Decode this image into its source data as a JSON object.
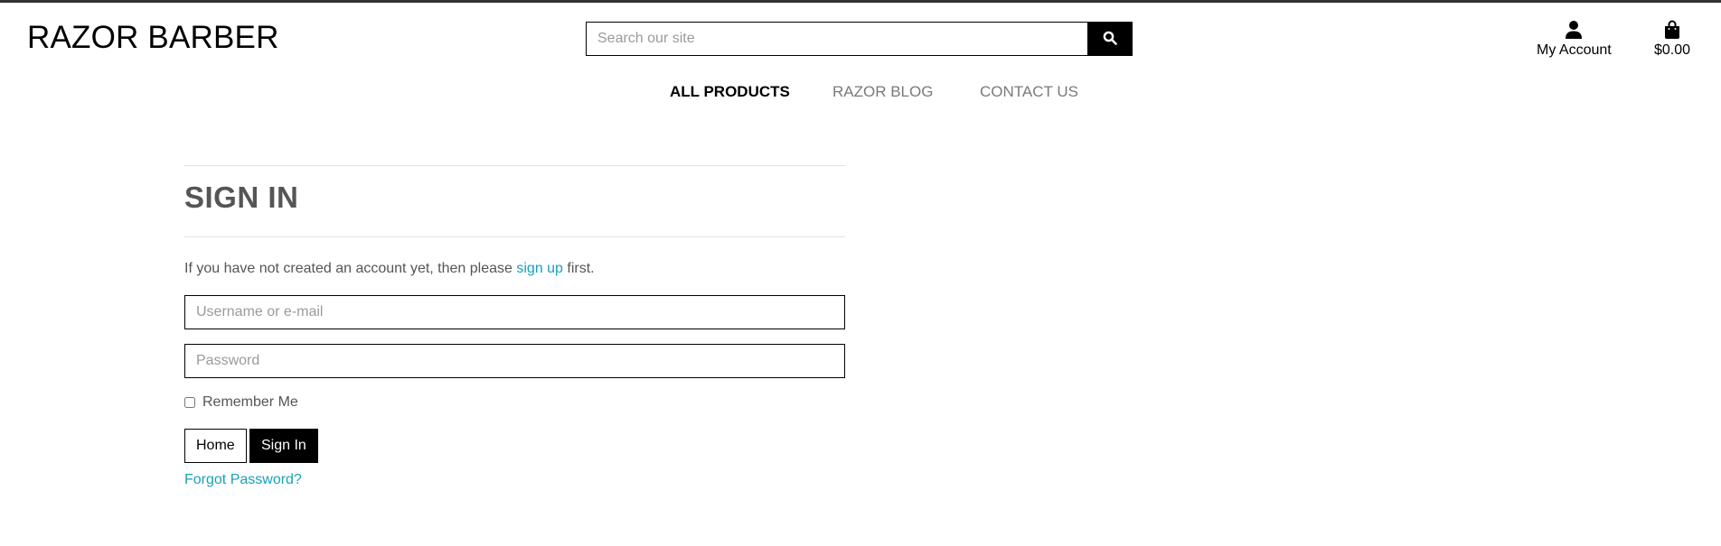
{
  "header": {
    "brand": "RAZOR BARBER",
    "search": {
      "placeholder": "Search our site",
      "button_icon": "search-icon"
    },
    "account": {
      "label": "My Account",
      "icon": "user-icon"
    },
    "bag": {
      "total": "$0.00",
      "icon": "shopping-bag-icon"
    }
  },
  "nav": {
    "items": [
      {
        "label": "ALL PRODUCTS",
        "active": true
      },
      {
        "label": "RAZOR BLOG",
        "active": false
      },
      {
        "label": "CONTACT US",
        "active": false
      }
    ]
  },
  "signin": {
    "title": "SIGN IN",
    "intro_before": "If you have not created an account yet, then please ",
    "intro_link": "sign up",
    "intro_after": " first.",
    "username_placeholder": "Username or e-mail",
    "password_placeholder": "Password",
    "remember_label": "Remember Me",
    "home_button": "Home",
    "signin_button": "Sign In",
    "forgot_link": "Forgot Password?"
  },
  "colors": {
    "accent_link": "#17a2b8",
    "primary_dark": "#000000",
    "text_muted": "#555555"
  }
}
